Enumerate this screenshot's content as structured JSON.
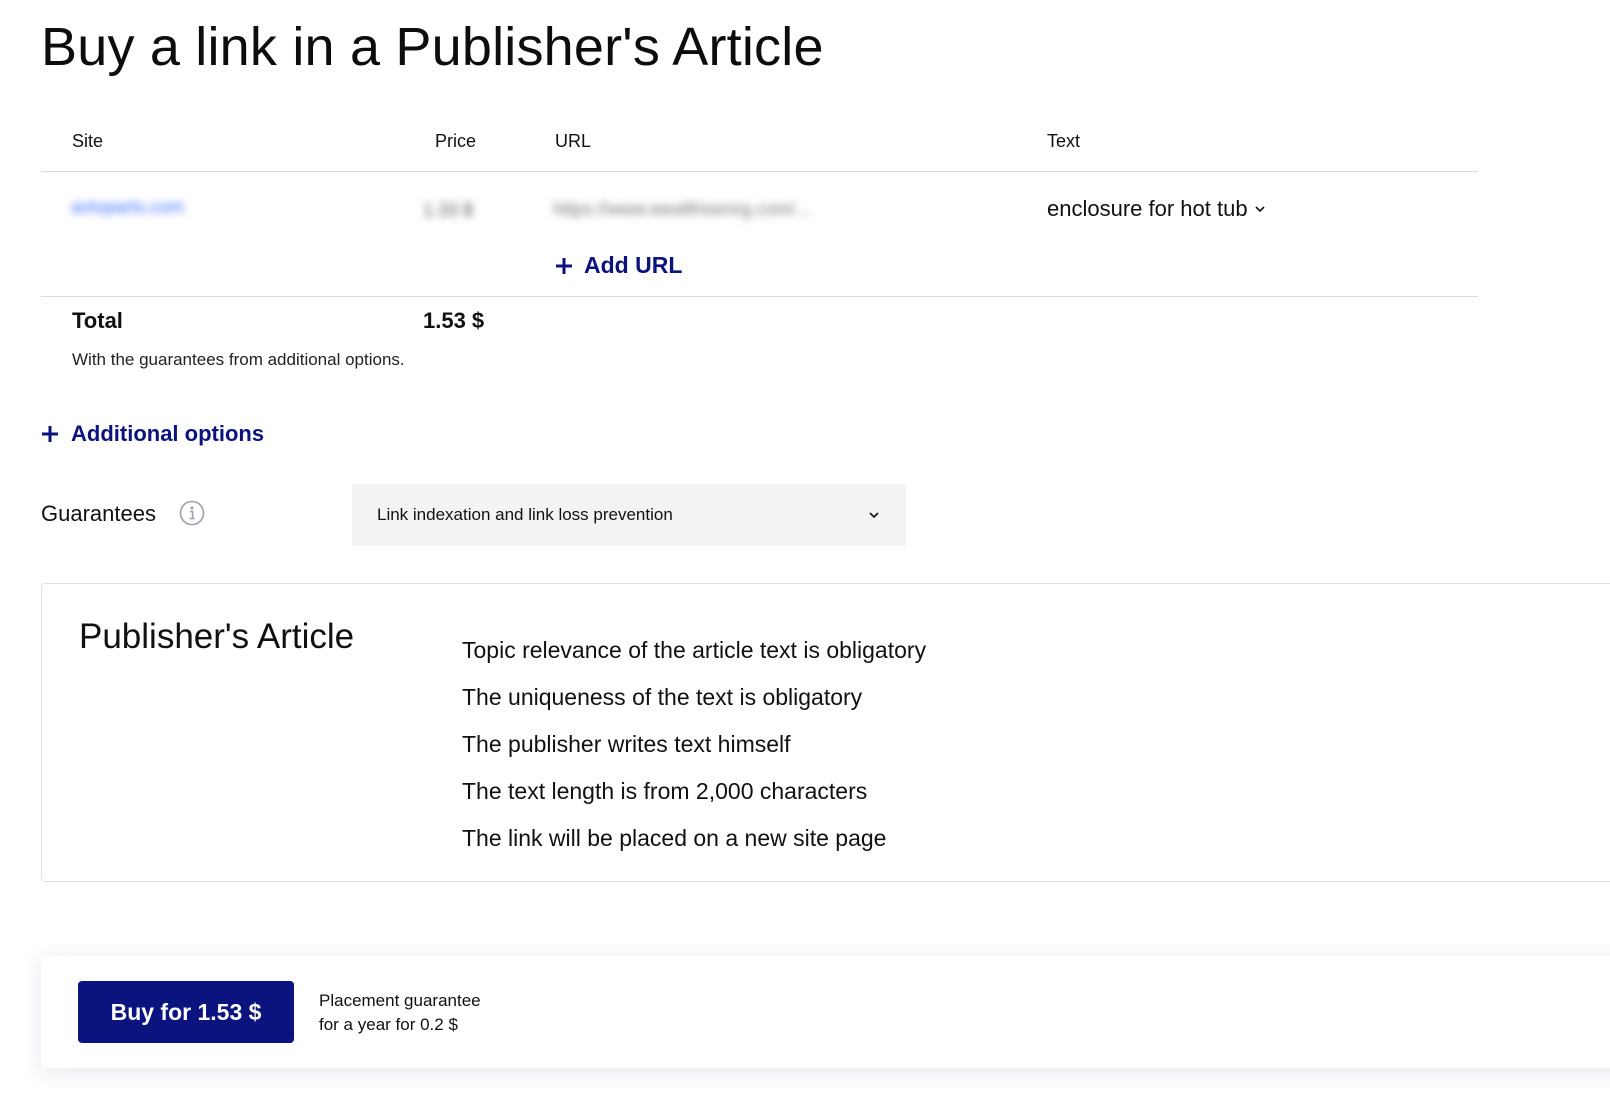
{
  "header": {
    "title": "Buy a link in a Publisher's Article"
  },
  "table": {
    "columns": {
      "site": "Site",
      "price": "Price",
      "url": "URL",
      "text": "Text"
    },
    "row": {
      "site": "avtoparts.com",
      "price": "1.33 $",
      "url": "https://www.wealthisenrg.com/...",
      "text": "enclosure for hot tub",
      "add_url_label": "Add URL"
    }
  },
  "total": {
    "label": "Total",
    "value": "1.53 $",
    "note": "With the guarantees from additional options."
  },
  "additional_options": {
    "label": "Additional options"
  },
  "guarantees": {
    "label": "Guarantees",
    "selected": "Link indexation and link loss prevention",
    "info_icon": "info-icon"
  },
  "article": {
    "title": "Publisher's Article",
    "features": [
      "Topic relevance of the article text is obligatory",
      "The uniqueness of the text is obligatory",
      "The publisher writes text himself",
      "The text length is from 2,000 characters",
      "The link will be placed on a new site page"
    ]
  },
  "buy": {
    "button_label": "Buy for 1.53 $",
    "note_line1": "Placement guarantee",
    "note_line2": "for a year for 0.2 $"
  },
  "colors": {
    "accent": "#0b137e",
    "border": "#d9dbe0",
    "select_bg": "#f2f3f5",
    "link": "#3b6bff"
  }
}
